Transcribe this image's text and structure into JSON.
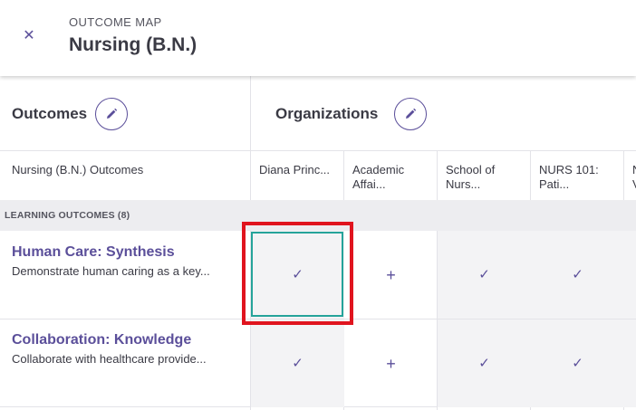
{
  "header": {
    "eyebrow": "OUTCOME MAP",
    "title": "Nursing (B.N.)",
    "close_icon": "close-icon"
  },
  "sections": {
    "outcomes_title": "Outcomes",
    "organizations_title": "Organizations",
    "edit_icon": "pencil-icon"
  },
  "columns": {
    "outcomes_label": "Nursing (B.N.) Outcomes",
    "organizations": [
      {
        "line1": "Diana Princ...",
        "line2": ""
      },
      {
        "line1": "Academic",
        "line2": "Affai..."
      },
      {
        "line1": "School of",
        "line2": "Nurs..."
      },
      {
        "line1": "NURS 101:",
        "line2": "Pati..."
      },
      {
        "line1": "N",
        "line2": "V"
      }
    ]
  },
  "group": {
    "label": "LEARNING OUTCOMES (8)"
  },
  "outcomes": [
    {
      "title": "Human Care: Synthesis",
      "description": "Demonstrate human caring as a key...",
      "cells": [
        "check",
        "plus",
        "check",
        "check"
      ]
    },
    {
      "title": "Collaboration: Knowledge",
      "description": "Collaborate with healthcare provide...",
      "cells": [
        "check",
        "plus",
        "check",
        "check"
      ]
    }
  ],
  "glyphs": {
    "check": "✓",
    "plus": "+"
  },
  "colors": {
    "accent": "#5b4f9a",
    "focus": "#25a39a",
    "highlight": "#e0141e"
  }
}
